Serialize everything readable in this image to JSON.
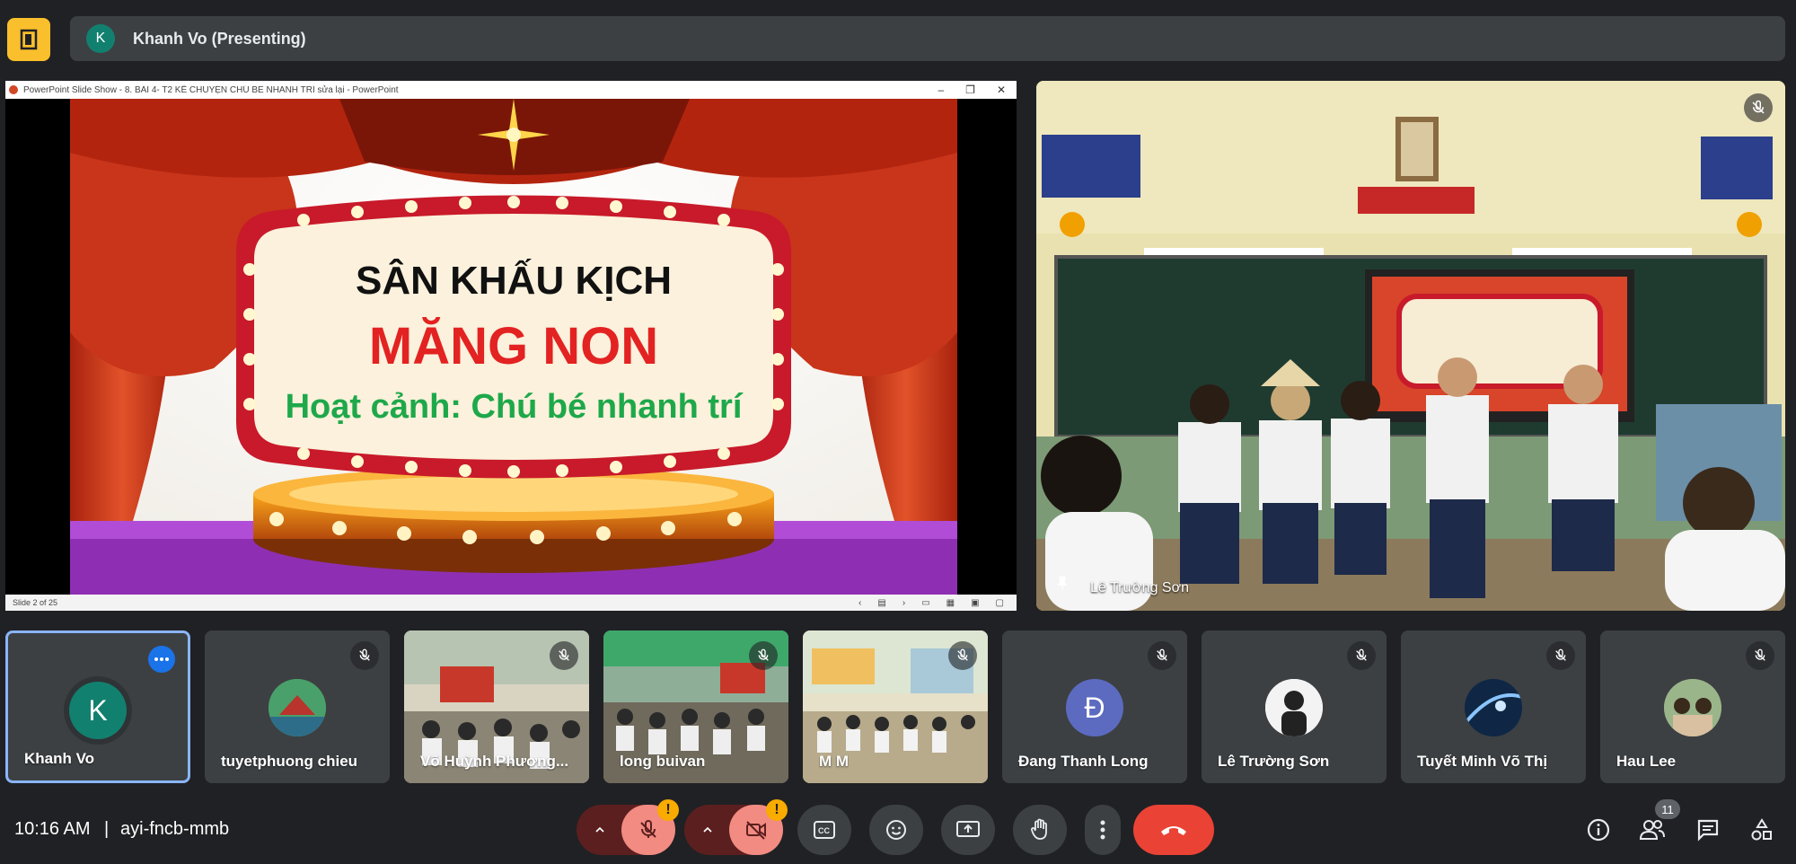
{
  "header": {
    "presenter_initial": "K",
    "presenter_label": "Khanh Vo (Presenting)"
  },
  "shared_screen": {
    "window_title": "PowerPoint Slide Show  -  8. BÀI 4- T2 KỂ CHUYỆN CHÚ BÉ NHANH TRÍ sửa lại - PowerPoint",
    "slide_line1": "SÂN KHẤU KỊCH",
    "slide_line2": "MĂNG NON",
    "slide_line3": "Hoạt cảnh: Chú bé nhanh trí",
    "slide_counter": "Slide 2 of 25"
  },
  "main_video": {
    "name": "Lê Trường Sơn"
  },
  "participants": [
    {
      "name": "Khanh Vo",
      "initial": "K",
      "avatar_color": "#12806f",
      "kind": "avatar"
    },
    {
      "name": "tuyetphuong chieu",
      "initial": "",
      "avatar_color": "#3e8e5a",
      "kind": "photo"
    },
    {
      "name": "Võ Huỳnh Phương...",
      "initial": "",
      "avatar_color": "",
      "kind": "video"
    },
    {
      "name": "long buivan",
      "initial": "",
      "avatar_color": "",
      "kind": "video"
    },
    {
      "name": "M M",
      "initial": "",
      "avatar_color": "",
      "kind": "video"
    },
    {
      "name": "Đang Thanh Long",
      "initial": "Đ",
      "avatar_color": "#5c6bc0",
      "kind": "avatar"
    },
    {
      "name": "Lê Trường Sơn",
      "initial": "",
      "avatar_color": "#eeeeee",
      "kind": "photo"
    },
    {
      "name": "Tuyết Minh Võ Thị",
      "initial": "",
      "avatar_color": "#1e3a5f",
      "kind": "photo"
    },
    {
      "name": "Hau Lee",
      "initial": "",
      "avatar_color": "#7a8a6a",
      "kind": "photo"
    }
  ],
  "bottom_bar": {
    "time": "10:16 AM",
    "separator": "|",
    "meeting_code": "ayi-fncb-mmb",
    "participant_count": "11"
  },
  "colors": {
    "background": "#202124",
    "surface": "#3c4043",
    "accent_blue": "#8ab4f8",
    "hangup_red": "#ea4335",
    "warning": "#f9ab00"
  }
}
